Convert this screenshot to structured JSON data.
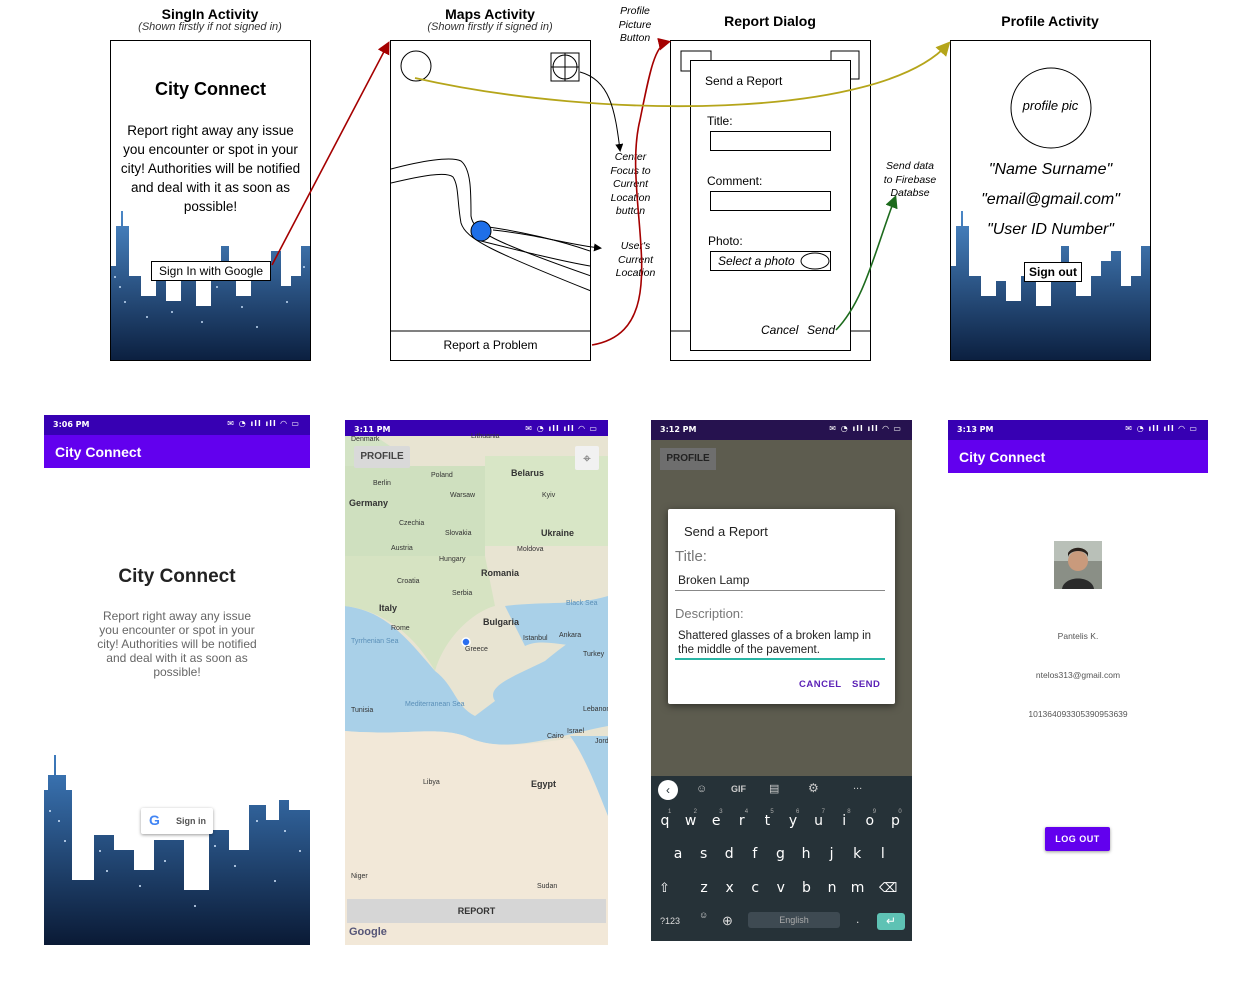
{
  "wireframes": {
    "signin": {
      "title": "SingIn Activity",
      "subtitle": "(Shown firstly if not signed in)",
      "app_name": "City Connect",
      "description": "Report right away any issue you encounter or spot in your city! Authorities will be notified and deal with it as soon as possible!",
      "button": "Sign In with Google"
    },
    "maps": {
      "title": "Maps Activity",
      "subtitle": "(Shown firstly if signed in)",
      "report_button": "Report a Problem"
    },
    "dialog": {
      "title": "Report Dialog",
      "heading": "Send a Report",
      "title_label": "Title:",
      "comment_label": "Comment:",
      "photo_label": "Photo:",
      "photo_button": "Select a photo",
      "cancel": "Cancel",
      "send": "Send"
    },
    "profile": {
      "title": "Profile Activity",
      "pic": "profile pic",
      "name": "\"Name Surname\"",
      "email": "\"email@gmail.com\"",
      "user_id": "\"User ID Number\"",
      "button": "Sign out"
    }
  },
  "annotations": {
    "profile_btn": [
      "Profile",
      "Picture",
      "Button"
    ],
    "center": [
      "Center",
      "Focus to",
      "Current",
      "Location",
      "button"
    ],
    "user_loc": [
      "User's",
      "Current",
      "Location"
    ],
    "firebase": [
      "Send data",
      "to Firebase",
      "Databse"
    ]
  },
  "colors": {
    "primary": "#6200ee",
    "status": "#3700b3",
    "red_arrow": "#a50000",
    "olive_arrow": "#b5a51a",
    "green_arrow": "#1d6b1d"
  },
  "screens": {
    "signin": {
      "time": "3:06 PM",
      "app_bar": "City Connect",
      "heading": "City Connect",
      "description": "Report right away any issue you encounter or spot in your city! Authorities will be notified and deal with it as soon as possible!",
      "button": "Sign in"
    },
    "maps": {
      "time": "3:11 PM",
      "profile_button": "PROFILE",
      "report_button": "REPORT",
      "logo": "Google",
      "labels": [
        "Denmark",
        "Lithuania",
        "Belarus",
        "Berlin",
        "Poland",
        "Warsaw",
        "Germany",
        "Kyiv",
        "Czechia",
        "Slovakia",
        "Ukraine",
        "Austria",
        "Hungary",
        "Moldova",
        "Croatia",
        "Romania",
        "Serbia",
        "Italy",
        "Bulgaria",
        "Black Sea",
        "Rome",
        "Tyrrhenian Sea",
        "Greece",
        "Ankara",
        "Istanbul",
        "Turkey",
        "Mediterranean Sea",
        "Tunisia",
        "Lebanon",
        "Cairo",
        "Israel",
        "Jordan",
        "Libya",
        "Egypt",
        "Niger",
        "Sudan"
      ]
    },
    "dialog": {
      "time": "3:12 PM",
      "heading": "Send a Report",
      "title_label": "Title:",
      "title_value": "Broken Lamp",
      "desc_label": "Description:",
      "desc_value": "Shattered glasses of a broken lamp in the middle of the pavement.",
      "cancel": "CANCEL",
      "send": "SEND",
      "kb_top": [
        "GIF",
        "..."
      ],
      "row1": [
        "q",
        "w",
        "e",
        "r",
        "t",
        "y",
        "u",
        "i",
        "o",
        "p"
      ],
      "row1_num": [
        "1",
        "2",
        "3",
        "4",
        "5",
        "6",
        "7",
        "8",
        "9",
        "0"
      ],
      "row2": [
        "a",
        "s",
        "d",
        "f",
        "g",
        "h",
        "j",
        "k",
        "l"
      ],
      "row3": [
        "z",
        "x",
        "c",
        "v",
        "b",
        "n",
        "m"
      ],
      "sym": "?123",
      "space": "English",
      "dot": "."
    },
    "profile": {
      "time": "3:13 PM",
      "app_bar": "City Connect",
      "name": "Pantelis K.",
      "email": "ntelos313@gmail.com",
      "user_id": "101364093305390953639",
      "button": "LOG OUT"
    }
  }
}
